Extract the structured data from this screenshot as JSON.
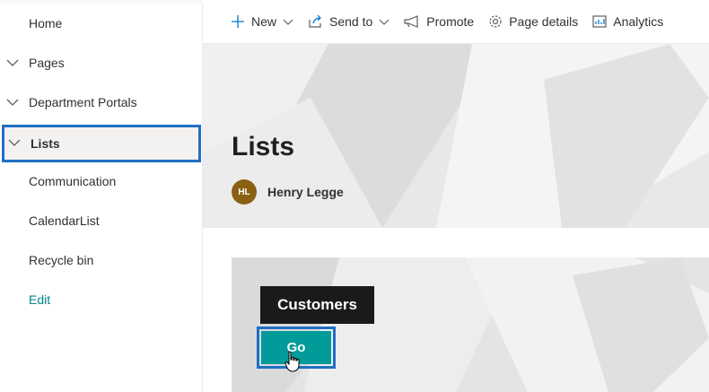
{
  "nav": {
    "items": [
      {
        "label": "Home"
      },
      {
        "label": "Pages"
      },
      {
        "label": "Department Portals"
      },
      {
        "label": "Lists"
      },
      {
        "label": "Communication"
      },
      {
        "label": "CalendarList"
      },
      {
        "label": "Recycle bin"
      },
      {
        "label": "Edit"
      }
    ],
    "selected": "Lists"
  },
  "commandbar": {
    "new": "New",
    "send_to": "Send to",
    "promote": "Promote",
    "page_details": "Page details",
    "analytics": "Analytics"
  },
  "hero": {
    "title": "Lists",
    "author_initials": "HL",
    "author_name": "Henry Legge"
  },
  "tile": {
    "label": "Customers",
    "button": "Go"
  },
  "colors": {
    "accent_teal": "#039a9a",
    "highlight_blue": "#1f6fc5",
    "avatar_brown": "#8a6113",
    "edit_link": "#038387"
  }
}
